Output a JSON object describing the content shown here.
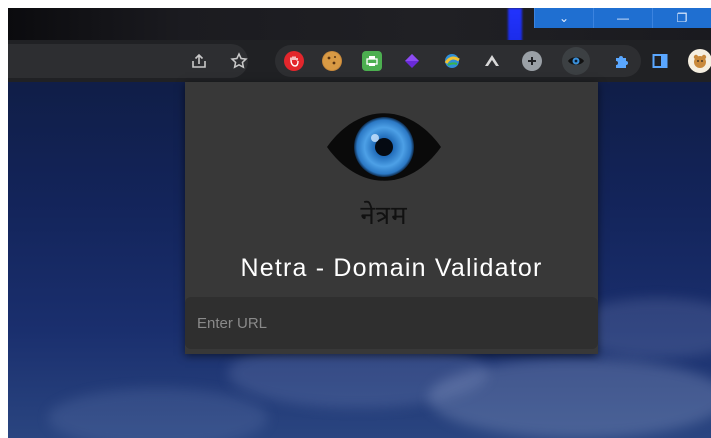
{
  "window": {
    "controls": [
      "⌄",
      "—",
      "❐"
    ]
  },
  "toolbar": {
    "icons": [
      "share-icon",
      "bookmark-star-icon"
    ],
    "extensions": [
      "adblock-icon",
      "cookie-icon",
      "print-icon",
      "gem-icon",
      "globe-icon",
      "vpn-icon",
      "plus-circle-icon",
      "netra-eye-icon",
      "puzzle-icon",
      "sidebar-icon",
      "profile-avatar-icon"
    ]
  },
  "popup": {
    "brand": "नेत्रम",
    "title": "Netra - Domain Validator",
    "url_input": {
      "placeholder": "Enter URL",
      "value": ""
    }
  },
  "colors": {
    "popup_bg": "#383838",
    "input_bg": "#2f2f2f",
    "toolbar_bg": "#202124",
    "window_btn": "#1f6fd1",
    "iris": "#3a8fd8"
  }
}
